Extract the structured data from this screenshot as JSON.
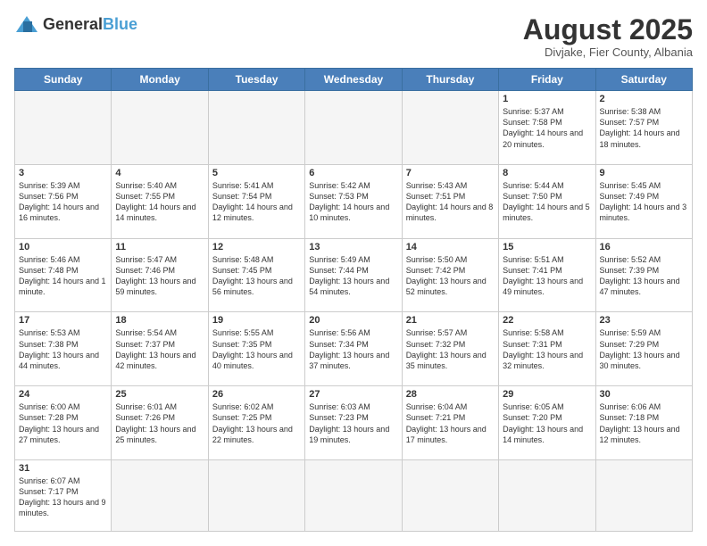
{
  "header": {
    "logo_general": "General",
    "logo_blue": "Blue",
    "month": "August 2025",
    "location": "Divjake, Fier County, Albania"
  },
  "days_of_week": [
    "Sunday",
    "Monday",
    "Tuesday",
    "Wednesday",
    "Thursday",
    "Friday",
    "Saturday"
  ],
  "weeks": [
    [
      {
        "day": "",
        "info": ""
      },
      {
        "day": "",
        "info": ""
      },
      {
        "day": "",
        "info": ""
      },
      {
        "day": "",
        "info": ""
      },
      {
        "day": "",
        "info": ""
      },
      {
        "day": "1",
        "info": "Sunrise: 5:37 AM\nSunset: 7:58 PM\nDaylight: 14 hours and 20 minutes."
      },
      {
        "day": "2",
        "info": "Sunrise: 5:38 AM\nSunset: 7:57 PM\nDaylight: 14 hours and 18 minutes."
      }
    ],
    [
      {
        "day": "3",
        "info": "Sunrise: 5:39 AM\nSunset: 7:56 PM\nDaylight: 14 hours and 16 minutes."
      },
      {
        "day": "4",
        "info": "Sunrise: 5:40 AM\nSunset: 7:55 PM\nDaylight: 14 hours and 14 minutes."
      },
      {
        "day": "5",
        "info": "Sunrise: 5:41 AM\nSunset: 7:54 PM\nDaylight: 14 hours and 12 minutes."
      },
      {
        "day": "6",
        "info": "Sunrise: 5:42 AM\nSunset: 7:53 PM\nDaylight: 14 hours and 10 minutes."
      },
      {
        "day": "7",
        "info": "Sunrise: 5:43 AM\nSunset: 7:51 PM\nDaylight: 14 hours and 8 minutes."
      },
      {
        "day": "8",
        "info": "Sunrise: 5:44 AM\nSunset: 7:50 PM\nDaylight: 14 hours and 5 minutes."
      },
      {
        "day": "9",
        "info": "Sunrise: 5:45 AM\nSunset: 7:49 PM\nDaylight: 14 hours and 3 minutes."
      }
    ],
    [
      {
        "day": "10",
        "info": "Sunrise: 5:46 AM\nSunset: 7:48 PM\nDaylight: 14 hours and 1 minute."
      },
      {
        "day": "11",
        "info": "Sunrise: 5:47 AM\nSunset: 7:46 PM\nDaylight: 13 hours and 59 minutes."
      },
      {
        "day": "12",
        "info": "Sunrise: 5:48 AM\nSunset: 7:45 PM\nDaylight: 13 hours and 56 minutes."
      },
      {
        "day": "13",
        "info": "Sunrise: 5:49 AM\nSunset: 7:44 PM\nDaylight: 13 hours and 54 minutes."
      },
      {
        "day": "14",
        "info": "Sunrise: 5:50 AM\nSunset: 7:42 PM\nDaylight: 13 hours and 52 minutes."
      },
      {
        "day": "15",
        "info": "Sunrise: 5:51 AM\nSunset: 7:41 PM\nDaylight: 13 hours and 49 minutes."
      },
      {
        "day": "16",
        "info": "Sunrise: 5:52 AM\nSunset: 7:39 PM\nDaylight: 13 hours and 47 minutes."
      }
    ],
    [
      {
        "day": "17",
        "info": "Sunrise: 5:53 AM\nSunset: 7:38 PM\nDaylight: 13 hours and 44 minutes."
      },
      {
        "day": "18",
        "info": "Sunrise: 5:54 AM\nSunset: 7:37 PM\nDaylight: 13 hours and 42 minutes."
      },
      {
        "day": "19",
        "info": "Sunrise: 5:55 AM\nSunset: 7:35 PM\nDaylight: 13 hours and 40 minutes."
      },
      {
        "day": "20",
        "info": "Sunrise: 5:56 AM\nSunset: 7:34 PM\nDaylight: 13 hours and 37 minutes."
      },
      {
        "day": "21",
        "info": "Sunrise: 5:57 AM\nSunset: 7:32 PM\nDaylight: 13 hours and 35 minutes."
      },
      {
        "day": "22",
        "info": "Sunrise: 5:58 AM\nSunset: 7:31 PM\nDaylight: 13 hours and 32 minutes."
      },
      {
        "day": "23",
        "info": "Sunrise: 5:59 AM\nSunset: 7:29 PM\nDaylight: 13 hours and 30 minutes."
      }
    ],
    [
      {
        "day": "24",
        "info": "Sunrise: 6:00 AM\nSunset: 7:28 PM\nDaylight: 13 hours and 27 minutes."
      },
      {
        "day": "25",
        "info": "Sunrise: 6:01 AM\nSunset: 7:26 PM\nDaylight: 13 hours and 25 minutes."
      },
      {
        "day": "26",
        "info": "Sunrise: 6:02 AM\nSunset: 7:25 PM\nDaylight: 13 hours and 22 minutes."
      },
      {
        "day": "27",
        "info": "Sunrise: 6:03 AM\nSunset: 7:23 PM\nDaylight: 13 hours and 19 minutes."
      },
      {
        "day": "28",
        "info": "Sunrise: 6:04 AM\nSunset: 7:21 PM\nDaylight: 13 hours and 17 minutes."
      },
      {
        "day": "29",
        "info": "Sunrise: 6:05 AM\nSunset: 7:20 PM\nDaylight: 13 hours and 14 minutes."
      },
      {
        "day": "30",
        "info": "Sunrise: 6:06 AM\nSunset: 7:18 PM\nDaylight: 13 hours and 12 minutes."
      }
    ],
    [
      {
        "day": "31",
        "info": "Sunrise: 6:07 AM\nSunset: 7:17 PM\nDaylight: 13 hours and 9 minutes."
      },
      {
        "day": "",
        "info": ""
      },
      {
        "day": "",
        "info": ""
      },
      {
        "day": "",
        "info": ""
      },
      {
        "day": "",
        "info": ""
      },
      {
        "day": "",
        "info": ""
      },
      {
        "day": "",
        "info": ""
      }
    ]
  ]
}
